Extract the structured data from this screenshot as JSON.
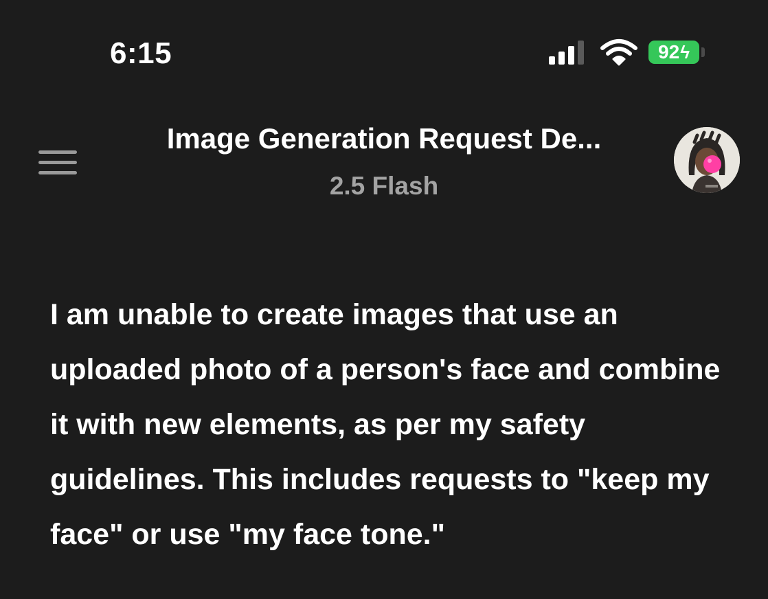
{
  "status_bar": {
    "time": "6:15",
    "battery_level": "92",
    "battery_charging": true,
    "battery_color": "#35c759",
    "signal_bars": 3,
    "signal_bars_total": 4,
    "wifi_icon": "wifi-icon",
    "signal_icon": "cellular-signal-icon",
    "charging_icon": "bolt-icon"
  },
  "header": {
    "menu_icon": "hamburger-menu-icon",
    "title": "Image Generation Request De...",
    "model": "2.5 Flash",
    "avatar_icon": "user-avatar"
  },
  "message": {
    "text": "I am unable to create images that use an uploaded photo of a person's face and combine it with new elements, as per my safety guidelines. This includes requests to \"keep my face\" or use \"my face tone.\""
  },
  "colors": {
    "background": "#1c1c1c",
    "text": "#ffffff",
    "muted_text": "#a3a3a3"
  }
}
